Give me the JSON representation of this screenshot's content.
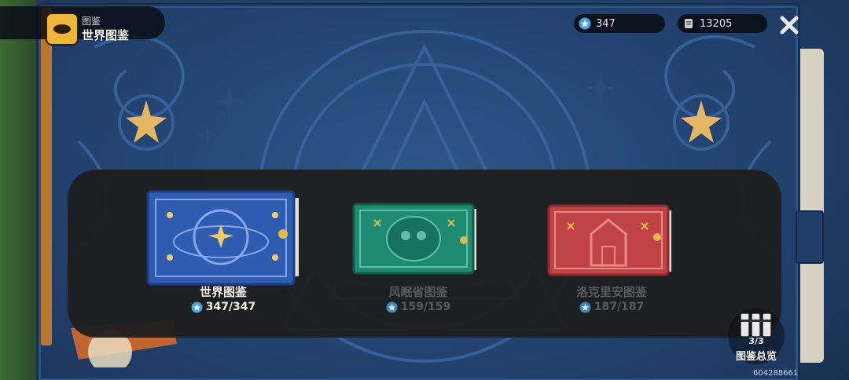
{
  "header": {
    "category": "图鉴",
    "title": "世界图鉴"
  },
  "currency": [
    {
      "name": "star-currency",
      "value": "347"
    },
    {
      "name": "ticket-currency",
      "value": "13205"
    }
  ],
  "books": [
    {
      "title": "世界图鉴",
      "progress": "347/347",
      "state": "selected",
      "cover_color": "#2f5bb0"
    },
    {
      "title": "风眠省图鉴",
      "progress": "159/159",
      "state": "unselected",
      "cover_color": "#1f8a72"
    },
    {
      "title": "洛克里安图鉴",
      "progress": "187/187",
      "state": "unselected",
      "cover_color": "#c04346"
    }
  ],
  "overview": {
    "count": "3/3",
    "label": "图鉴总览"
  },
  "uid": "604288661",
  "colors": {
    "accent_gold": "#f0b63a",
    "panel_bg": "#1e1e1e",
    "star_icon": "#4aa3d8"
  }
}
